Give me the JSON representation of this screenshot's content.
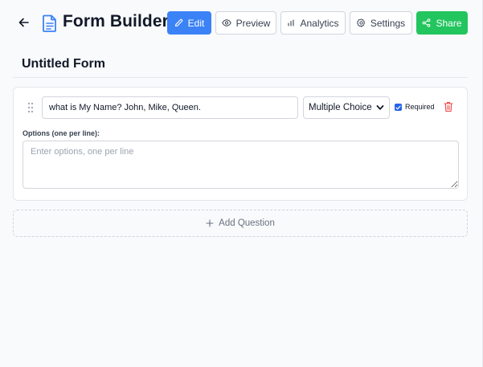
{
  "header": {
    "back_icon": "arrow-left-icon",
    "doc_icon": "document-icon",
    "title": "Form Builder",
    "buttons": {
      "edit": {
        "label": "Edit",
        "icon": "pencil-icon"
      },
      "preview": {
        "label": "Preview",
        "icon": "eye-icon"
      },
      "analytics": {
        "label": "Analytics",
        "icon": "bar-chart-icon"
      },
      "settings": {
        "label": "Settings",
        "icon": "gear-icon"
      },
      "share": {
        "label": "Share",
        "icon": "share-icon"
      }
    }
  },
  "form": {
    "title": "Untitled Form",
    "questions": [
      {
        "text": "what is My Name? John, Mike, Queen.",
        "type": "Multiple Choice",
        "required_label": "Required",
        "required": true,
        "options_label": "Options (one per line):",
        "options_placeholder": "Enter options, one per line"
      }
    ],
    "add_question_label": "Add Question"
  },
  "colors": {
    "primary": "#3b82f6",
    "share": "#22c55e",
    "danger": "#ef4444",
    "background": "#f8fafc"
  }
}
